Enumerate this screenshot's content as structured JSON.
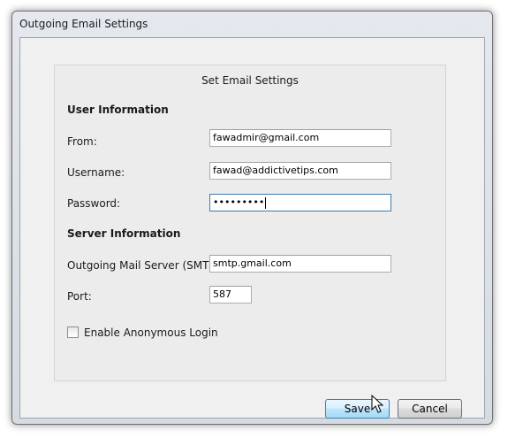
{
  "window": {
    "title": "Outgoing Email Settings"
  },
  "panel": {
    "title": "Set Email Settings"
  },
  "user_info": {
    "heading": "User Information",
    "from_label": "From:",
    "from_value": "fawadmir@gmail.com",
    "username_label": "Username:",
    "username_value": "fawad@addictivetips.com",
    "password_label": "Password:",
    "password_value": "•••••••••"
  },
  "server_info": {
    "heading": "Server Information",
    "smtp_label": "Outgoing Mail Server (SMTP):",
    "smtp_value": "smtp.gmail.com",
    "port_label": "Port:",
    "port_value": "587"
  },
  "anonymous": {
    "label": "Enable Anonymous Login",
    "checked": false
  },
  "buttons": {
    "save": "Save",
    "cancel": "Cancel"
  },
  "icons": {
    "cursor": "mouse-pointer-icon"
  },
  "colors": {
    "default_button_border": "#3c7fb1",
    "focused_field_border": "#3d7bad"
  }
}
